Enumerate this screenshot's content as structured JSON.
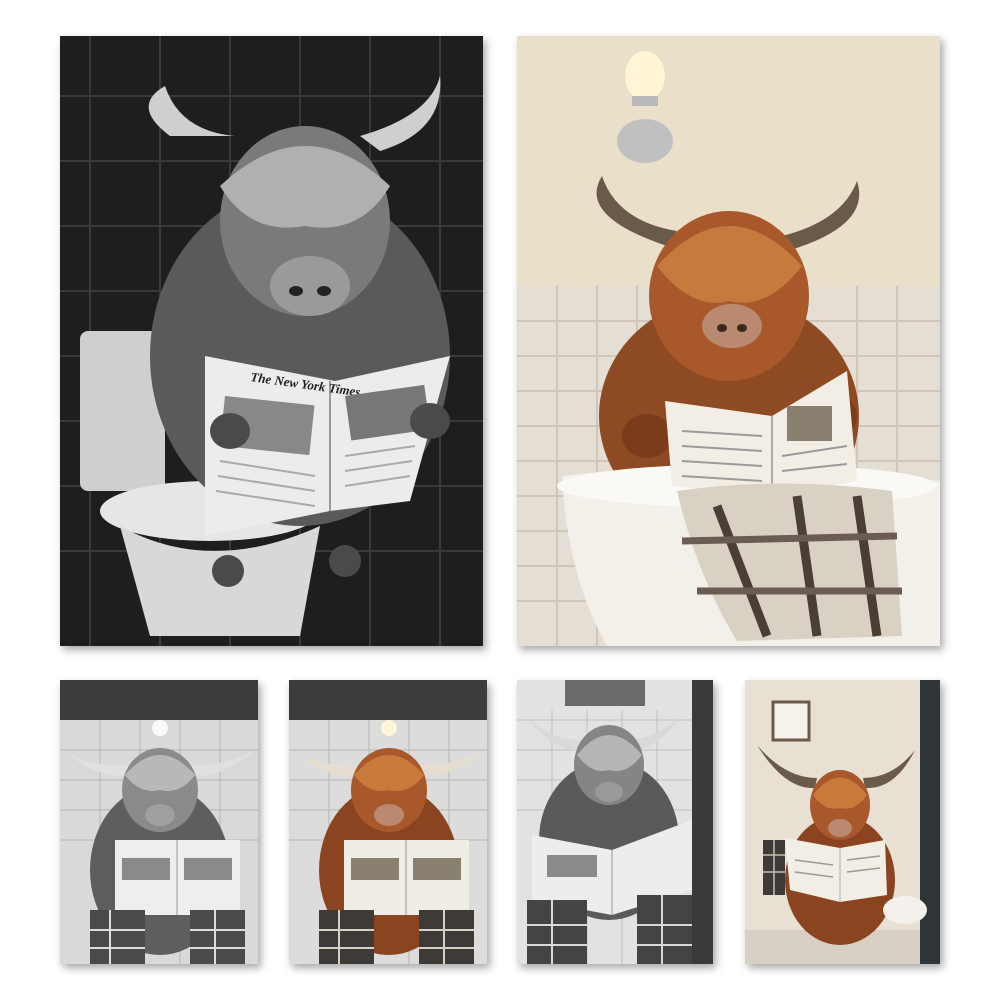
{
  "canvases": [
    {
      "id": "c1",
      "tone": "monochrome",
      "scene": "toilet",
      "newspaper_headline": "The New York Times"
    },
    {
      "id": "c2",
      "tone": "color",
      "scene": "bathtub",
      "newspaper_headline": ""
    },
    {
      "id": "c3",
      "tone": "monochrome",
      "scene": "toilet",
      "newspaper_headline": ""
    },
    {
      "id": "c4",
      "tone": "color",
      "scene": "toilet",
      "newspaper_headline": ""
    },
    {
      "id": "c5",
      "tone": "monochrome",
      "scene": "toilet",
      "newspaper_headline": ""
    },
    {
      "id": "c6",
      "tone": "color",
      "scene": "toilet",
      "newspaper_headline": ""
    }
  ],
  "colors": {
    "fur_color": "#a8582a",
    "fur_mono": "#6a6a6a",
    "bath_wall": "#e9dcc6",
    "dark_tile": "#2a2a2a"
  }
}
